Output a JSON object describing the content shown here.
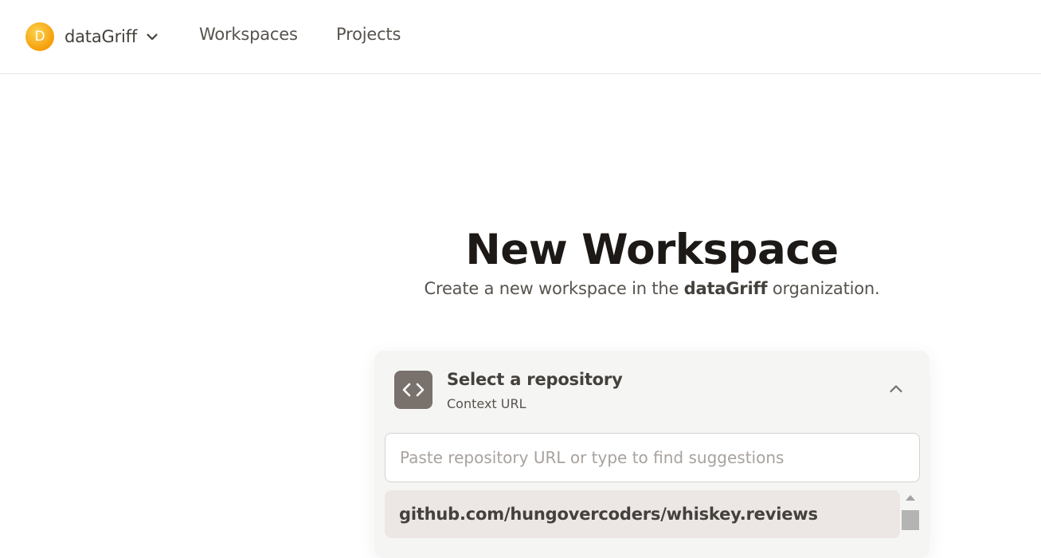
{
  "header": {
    "org_initial": "D",
    "org_name": "dataGriff",
    "nav": {
      "workspaces": "Workspaces",
      "projects": "Projects"
    }
  },
  "main": {
    "title": "New Workspace",
    "subtitle_prefix": "Create a new workspace in the ",
    "subtitle_org": "dataGriff",
    "subtitle_suffix": " organization."
  },
  "repo_selector": {
    "title": "Select a repository",
    "subtitle": "Context URL",
    "input_value": "",
    "input_placeholder": "Paste repository URL or type to find suggestions",
    "suggestions": [
      "github.com/hungovercoders/whiskey.reviews"
    ]
  },
  "icons": {
    "org_switch_chevron": "chevron-down-icon",
    "repo_icon": "code-brackets-icon",
    "collapse": "chevron-up-icon"
  },
  "colors": {
    "org_avatar": "#f59e0b",
    "repo_icon_bg": "#78716c",
    "card_bg": "#f5f5f4",
    "suggestion_bg": "#ece7e5"
  }
}
